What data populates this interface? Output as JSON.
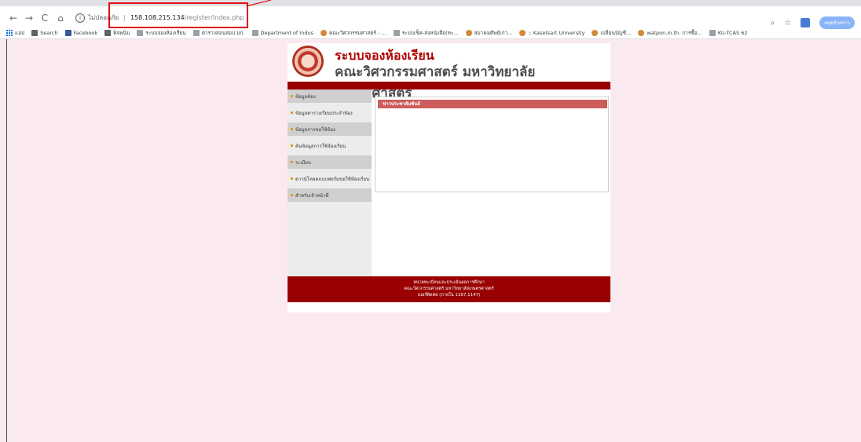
{
  "browser": {
    "insecure_label": "ไม่ปลอดภัย",
    "url_host": "158.108.215.134",
    "url_path": "/register/index.php",
    "profile_label": "หยุดชั่วคราว",
    "bookmarks": [
      {
        "label": "แอป",
        "icon": "apps-icon"
      },
      {
        "label": "Search",
        "icon": "search-icon"
      },
      {
        "label": "Facebook",
        "icon": "facebook-icon"
      },
      {
        "label": "พิจพนิม",
        "icon": "bookmark-icon"
      },
      {
        "label": "ระบบจองห้องเรียน",
        "icon": "page-icon"
      },
      {
        "label": "ตารางสอนสอบ มก.",
        "icon": "page-icon"
      },
      {
        "label": "Department of Indus",
        "icon": "page-icon"
      },
      {
        "label": "คณะวิศวกรรมศาสตร์ - ...",
        "icon": "site-icon"
      },
      {
        "label": "ระบบเช็ค-ส่งหนังสือ(ทะ...",
        "icon": "page-icon"
      },
      {
        "label": "สมาคมศิษย์เก่า...",
        "icon": "site-icon"
      },
      {
        "label": ":: Kasetsart University",
        "icon": "site-icon"
      },
      {
        "label": "เปลี่ยนบัญชี...",
        "icon": "site-icon"
      },
      {
        "label": "watpon.in.th: การซื้อ...",
        "icon": "site-icon"
      },
      {
        "label": "KU-TCAS 62",
        "icon": "page-icon"
      }
    ]
  },
  "site": {
    "title": "ระบบจองห้องเรียน",
    "subtitle": "คณะวิศวกรรมศาสตร์ มหาวิทยาลัยเกษตรศาสตร์"
  },
  "menu": [
    {
      "label": "ข้อมูลห้อง",
      "dark": true
    },
    {
      "label": "ข้อมูลตารางเรียนประจำห้อง",
      "dark": false
    },
    {
      "label": "ข้อมูลการขอใช้ห้อง",
      "dark": true
    },
    {
      "label": "ค้นข้อมูลการใช้ห้องเรียน",
      "dark": false
    },
    {
      "label": "ระเบียบ",
      "dark": true
    },
    {
      "label": "ดาวน์โหลดแบบฟอร์มขอใช้ห้องเรียน",
      "dark": false
    },
    {
      "label": "สำหรับเจ้าหน้าที่",
      "dark": true
    }
  ],
  "news": {
    "heading": "ข่าวประชาสัมพันธ์"
  },
  "footer": {
    "line1": "หน่วยทะเบียนและประเมินผลการศึกษา",
    "line2": "คณะวิศวกรรมศาสตร์ มหาวิทยาลัยเกษตรศาสตร์",
    "line3": "เบอร์ติดต่อ (ภายใน 1167,1147)"
  },
  "colors": {
    "page_bg": "#fbe9f0",
    "brand_red": "#990000",
    "news_head": "#cd5c5c",
    "highlight": "#e01010"
  }
}
